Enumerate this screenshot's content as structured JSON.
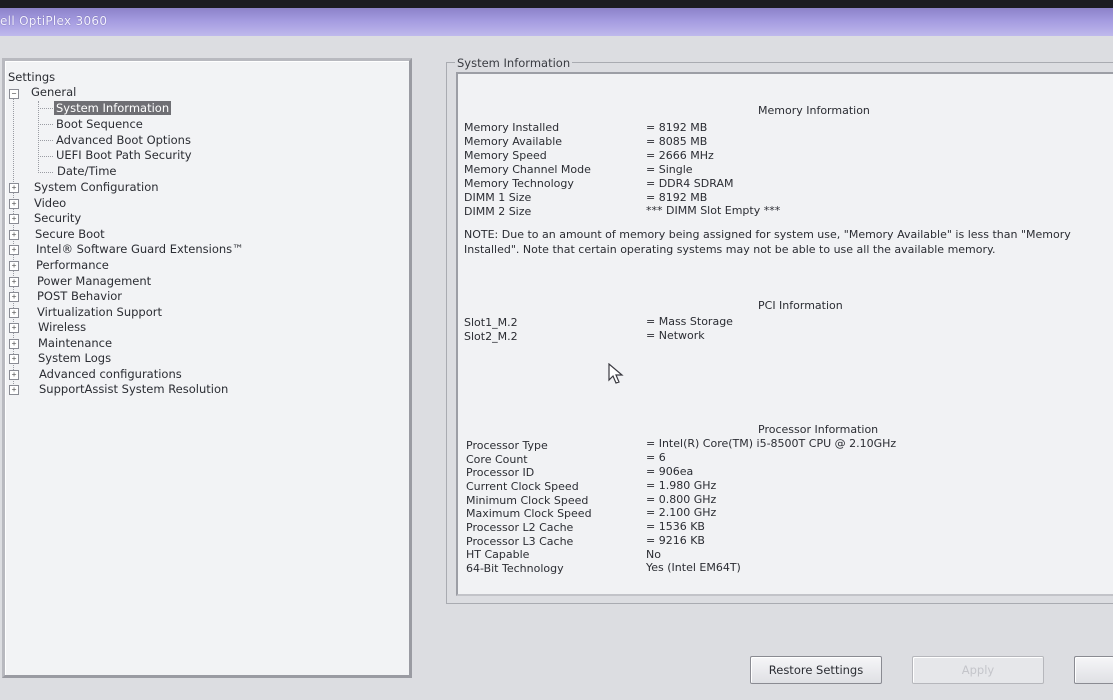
{
  "window": {
    "title": "ell OptiPlex 3060"
  },
  "tree": {
    "root": "Settings",
    "general": {
      "label": "General",
      "children": [
        "System Information",
        "Boot Sequence",
        "Advanced Boot Options",
        "UEFI Boot Path Security",
        "Date/Time"
      ]
    },
    "items": [
      "System Configuration",
      "Video",
      "Security",
      "Secure Boot",
      "Intel® Software Guard Extensions™",
      "Performance",
      "Power Management",
      "POST Behavior",
      "Virtualization Support",
      "Wireless",
      "Maintenance",
      "System Logs",
      "Advanced configurations",
      "SupportAssist System Resolution"
    ]
  },
  "group_title": "System Information",
  "memory": {
    "title": "Memory Information",
    "rows": [
      {
        "label": "Memory Installed",
        "value": "= 8192 MB"
      },
      {
        "label": "Memory Available",
        "value": "= 8085 MB"
      },
      {
        "label": "Memory Speed",
        "value": "= 2666 MHz"
      },
      {
        "label": "Memory Channel Mode",
        "value": "= Single"
      },
      {
        "label": "Memory Technology",
        "value": "= DDR4 SDRAM"
      },
      {
        "label": "DIMM 1 Size",
        "value": "= 8192 MB"
      },
      {
        "label": "DIMM 2 Size",
        "value": "*** DIMM Slot Empty ***"
      }
    ],
    "note": "NOTE: Due to an amount of memory being assigned for system use, \"Memory Available\" is less than \"Memory Installed\". Note that certain operating systems may not be able to use all the available memory."
  },
  "pci": {
    "title": "PCI Information",
    "rows": [
      {
        "label": "Slot1_M.2",
        "value": "= Mass Storage"
      },
      {
        "label": "Slot2_M.2",
        "value": "= Network"
      }
    ]
  },
  "processor": {
    "title": "Processor Information",
    "rows": [
      {
        "label": "Processor Type",
        "value": "= Intel(R) Core(TM) i5-8500T CPU @ 2.10GHz"
      },
      {
        "label": "Core Count",
        "value": "= 6"
      },
      {
        "label": "Processor ID",
        "value": "= 906ea"
      },
      {
        "label": "Current Clock Speed",
        "value": "= 1.980 GHz"
      },
      {
        "label": "Minimum Clock Speed",
        "value": "= 0.800 GHz"
      },
      {
        "label": "Maximum Clock Speed",
        "value": "= 2.100 GHz"
      },
      {
        "label": "Processor L2 Cache",
        "value": "= 1536 KB"
      },
      {
        "label": "Processor L3 Cache",
        "value": "= 9216 KB"
      },
      {
        "label": "HT Capable",
        "value": "No"
      },
      {
        "label": "64-Bit Technology",
        "value": "Yes (Intel EM64T)"
      }
    ]
  },
  "buttons": {
    "restore": "Restore Settings",
    "apply": "Apply"
  }
}
